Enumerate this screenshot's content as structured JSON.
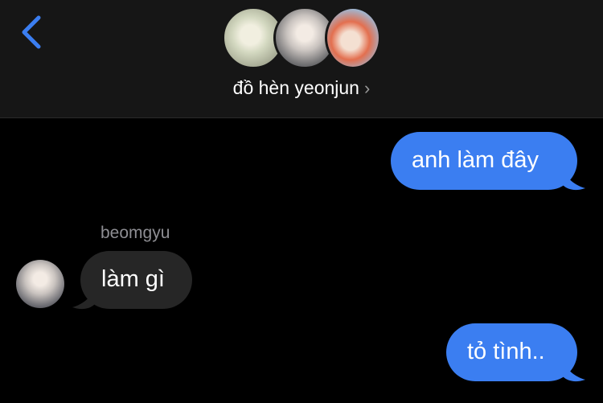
{
  "header": {
    "back_icon": "chevron-left-icon",
    "group_name": "đồ hèn yeonjun",
    "chevron": "›",
    "avatars": [
      "avatar-1",
      "avatar-2",
      "avatar-3"
    ]
  },
  "messages": [
    {
      "direction": "outgoing",
      "text": "anh làm đây"
    },
    {
      "direction": "incoming",
      "sender": "beomgyu",
      "text": "làm gì"
    },
    {
      "direction": "outgoing",
      "text": "tỏ tình.."
    }
  ],
  "colors": {
    "outgoing_bubble": "#3b7ef1",
    "incoming_bubble": "#262626",
    "header_bg": "#161616",
    "background": "#000000",
    "accent": "#3b7ef1"
  }
}
